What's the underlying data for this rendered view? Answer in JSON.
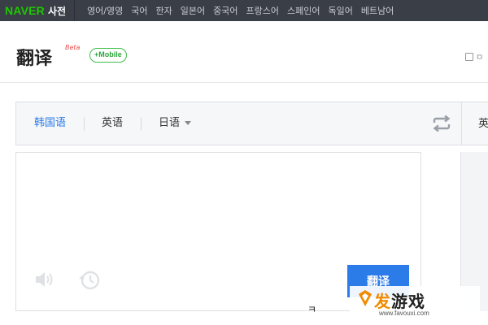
{
  "topbar": {
    "logo_brand": "NAVER",
    "logo_service": "사전",
    "nav_items": [
      "영어/영영",
      "국어",
      "한자",
      "일본어",
      "중국어",
      "프랑스어",
      "스페인어",
      "독일어",
      "베트남어"
    ]
  },
  "header": {
    "title": "翻译",
    "beta": "Beta",
    "mobile_badge": "+Mobile",
    "right_label": "ㅁ"
  },
  "translator": {
    "source_tabs": [
      {
        "label": "韩国语",
        "active": true
      },
      {
        "label": "英语",
        "active": false
      },
      {
        "label": "日语",
        "active": false,
        "dropdown": true
      }
    ],
    "target_lang": "英",
    "input_value": "",
    "translate_button": "翻译",
    "icons": {
      "swap": "swap-arrows-icon",
      "speaker": "speaker-icon",
      "history": "history-icon"
    },
    "stray_char": "ㅋ"
  },
  "watermark": {
    "text_orange": "发",
    "text_rest": "游戏",
    "url": "www.favouxi.com"
  },
  "colors": {
    "topbar": "#3a3e47",
    "brand_green": "#1ec800",
    "accent_blue": "#2b7be8",
    "watermark_orange": "#f08a00"
  }
}
